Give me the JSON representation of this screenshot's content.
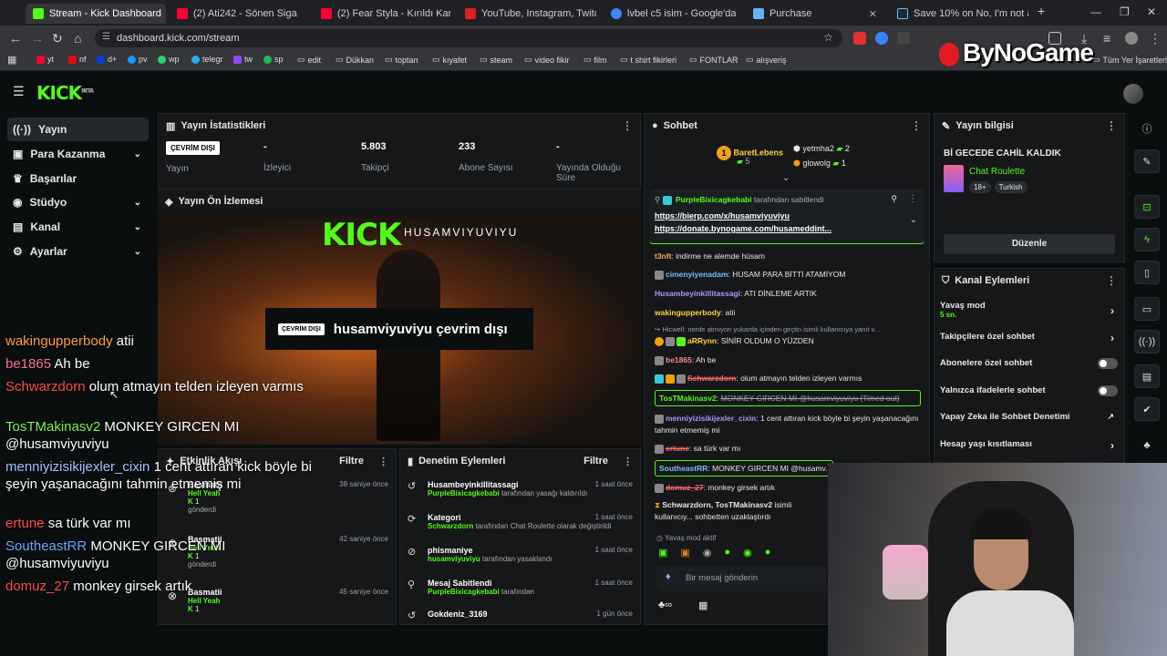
{
  "browser": {
    "tabs": [
      {
        "title": "Stream - Kick Dashboard",
        "color": "#53fc18"
      },
      {
        "title": "(2) Ati242 - Sönen Sigaralar",
        "color": "#ff0033"
      },
      {
        "title": "(2) Fear Styla - Kırıldı Karyola",
        "color": "#ff0033"
      },
      {
        "title": "YouTube, Instagram, Twitch, Tik",
        "color": "#e02020"
      },
      {
        "title": "lvbel c5 isim - Google'da Ara",
        "color": "#4285f4"
      },
      {
        "title": "Purchase",
        "color": "#6ab0f3"
      },
      {
        "title": "Save 10% on No, I'm not a Hum",
        "color": "#1b2838"
      }
    ],
    "url": "dashboard.kick.com/stream",
    "bookmarks": [
      "yt",
      "nf",
      "d+",
      "pv",
      "wp",
      "telegr",
      "tw",
      "sp",
      "edit",
      "Dükkan",
      "toptan",
      "kıyafet",
      "steam",
      "video fikir",
      "film",
      "t shirt fikirleri",
      "FONTLAR",
      "alışveriş"
    ],
    "all_bookmarks": "Tüm Yer İşaretleri",
    "overlay_logo": "ByNoGame"
  },
  "sidebar": {
    "items": [
      {
        "label": "Yayın",
        "icon": "signal-icon",
        "chev": ""
      },
      {
        "label": "Para Kazanma",
        "icon": "money-icon",
        "chev": "⌄"
      },
      {
        "label": "Başarılar",
        "icon": "trophy-icon",
        "chev": ""
      },
      {
        "label": "Stüdyo",
        "icon": "studio-icon",
        "chev": "⌄"
      },
      {
        "label": "Kanal",
        "icon": "channel-icon",
        "chev": "⌄"
      },
      {
        "label": "Ayarlar",
        "icon": "gear-icon",
        "chev": "⌄"
      }
    ]
  },
  "stats": {
    "title": "Yayın İstatistikleri",
    "status_badge": "ÇEVRİM DIŞI",
    "status_label": "Yayın",
    "viewers_value": "-",
    "viewers_label": "İzleyici",
    "followers_value": "5.803",
    "followers_label": "Takipçi",
    "subs_value": "233",
    "subs_label": "Abone Sayısı",
    "uptime_value": "-",
    "uptime_label": "Yayında Olduğu Süre"
  },
  "preview": {
    "title": "Yayın Ön İzlemesi",
    "banner_brand": "KICK",
    "banner_name": "HUSAMVIYUVIYU",
    "offline_badge": "ÇEVRİM DIŞI",
    "offline_text": "husamviyuviyu çevrim dışı"
  },
  "activity": {
    "title": "Etkinlik Akışı",
    "filter": "Filtre",
    "items": [
      {
        "user": "Basmatii",
        "sub": "Hell Yeah",
        "gift": "1",
        "verb": "gönderdi",
        "time": "38 saniye önce"
      },
      {
        "user": "Basmatii",
        "sub": "Hell Yeah",
        "gift": "1",
        "verb": "gönderdi",
        "time": "42 saniye önce"
      },
      {
        "user": "Basmatii",
        "sub": "Hell Yeah",
        "gift": "1",
        "verb": "",
        "time": "45 saniye önce"
      }
    ]
  },
  "moderation": {
    "title": "Denetim Eylemleri",
    "filter": "Filtre",
    "items": [
      {
        "head": "Husambeyinkillitassagi",
        "by": "PurpleBixicagkebabi",
        "rest": "tarafından yasağı kaldırıldı",
        "time": "1 saat önce",
        "icon": "undo-icon"
      },
      {
        "head": "Kategori",
        "by": "Schwarzdorn",
        "rest": "tarafından Chat Roulette olarak değiştirildi",
        "time": "1 saat önce",
        "icon": "refresh-icon"
      },
      {
        "head": "phismaniye",
        "by": "husamviyuviyu",
        "rest": "tarafından yasaklandı",
        "time": "1 saat önce",
        "icon": "ban-icon"
      },
      {
        "head": "Mesaj Sabitlendi",
        "by": "PurpleBixicagkebabi",
        "rest": "tarafından",
        "time": "1 saat önce",
        "icon": "pin-icon"
      },
      {
        "head": "Gokdeniz_3169",
        "by": "",
        "rest": "",
        "time": "1 gün önce",
        "icon": "undo-icon"
      }
    ]
  },
  "chat": {
    "title": "Sohbet",
    "top_gifters": [
      {
        "name": "BaretLebens",
        "count": "5"
      },
      {
        "name": "yetmha2",
        "count": "2"
      },
      {
        "name": "glowolg",
        "count": "1"
      }
    ],
    "pinned_by": "PurpleBixicagkebabi",
    "pinned_suffix": "tarafından sabitlendi",
    "pinned_link1": "https://bierp.com/x/husamviyuviyu",
    "pinned_link2": "https://donate.bynogame.com/husameddint...",
    "messages": [
      {
        "name": "t3nft",
        "color": "#ffa94d",
        "text": "indirme ne alemde hüsam"
      },
      {
        "name": "cimenyiyenadam",
        "color": "#74c0fc",
        "text": "HUSAM PARA BİTTİ ATAMİYOM"
      },
      {
        "name": "Husambeyinkillitassagi",
        "color": "#b197fc",
        "text": "ATI DİNLEME ARTIK"
      },
      {
        "name": "wakingupperbody",
        "color": "#ffd43b",
        "text": "atii"
      },
      {
        "name": "Hicwell",
        "color": "#9aa0a6",
        "text": "nerde atmıyon yukarda içinden geçtin isimli kullanıcıya yanıt v..."
      },
      {
        "name": "aRRynn",
        "color": "#ffd43b",
        "text": "SİNİR OLDUM O YÜZDEN"
      },
      {
        "name": "be1865",
        "color": "#ff8787",
        "text": "Ah be"
      },
      {
        "name": "Schwarzdorn",
        "color": "#ff6b6b",
        "text": "olum atmayın telden izleyen varmıs"
      },
      {
        "name": "TosTMakinasv2",
        "color": "#53fc18",
        "text": "MONKEY GIRCEN MI @husamviyuviyu (Timed out)"
      },
      {
        "name": "menniyizisikijexler_cixin",
        "color": "#b197fc",
        "text": "1 cent attıran kick böyle bi şeyin yaşanacağını tahmin etmemiş mi"
      },
      {
        "name": "ertune",
        "color": "#ff6b6b",
        "text": "sa türk var mı"
      },
      {
        "name": "SoutheastRR",
        "color": "#74c0fc",
        "text": "MONKEY GIRCEN MI @husamv..."
      },
      {
        "name": "domuz_27",
        "color": "#ff6b6b",
        "text": "monkey girsek artık"
      },
      {
        "name": "Schwarzdorn, TosTMakinasv2",
        "color": "#e8e8e8",
        "text": "isimli kullanıcıy... sohbetten uzaklaştırdı"
      }
    ],
    "slow_mode": "Yavaş mod aktif",
    "input_placeholder": "Bir mesaj gönderin"
  },
  "stream_info": {
    "title": "Yayın bilgisi",
    "stream_title": "Bİ GECEDE CAHİL KALDIK",
    "category": "Chat Roulette",
    "tag1": "18+",
    "tag2": "Turkish",
    "edit_button": "Düzenle"
  },
  "channel_actions": {
    "title": "Kanal Eylemleri",
    "slow_mode": "Yavaş mod",
    "slow_mode_value": "5 sn.",
    "followers_only": "Takipçilere özel sohbet",
    "subs_only": "Abonelere özel sohbet",
    "emotes_only": "Yalnızca ifadelerle sohbet",
    "ai_moderation": "Yapay Zeka ile Sohbet Denetimi",
    "account_age": "Hesap yaşı kısıtlaması"
  },
  "overlay_chat": [
    {
      "name": "wakingupperbody",
      "color": "#ff9f43",
      "text": "atii"
    },
    {
      "name": "be1865",
      "color": "#ff6b9d",
      "text": "Ah be"
    },
    {
      "name": "Schwarzdorn",
      "color": "#ff4d4d",
      "text": "olum atmayın telden izleyen varmıs"
    },
    {
      "name": "TosTMakinasv2",
      "color": "#7cf25a",
      "text": "MONKEY GIRCEN MI @husamviyuviyu"
    },
    {
      "name": "menniyizisikijexler_cixin",
      "color": "#9ec5ff",
      "text": "1 cent attıran kick böyle bi şeyin yaşanacağını tahmin etmemiş mi"
    },
    {
      "name": "ertune",
      "color": "#ff4d4d",
      "text": "sa türk var mı"
    },
    {
      "name": "SoutheastRR",
      "color": "#6fa8ff",
      "text": "MONKEY GIRCEN MI @husamviyuviyu"
    },
    {
      "name": "domuz_27",
      "color": "#ff4d4d",
      "text": "monkey girsek artık"
    }
  ]
}
